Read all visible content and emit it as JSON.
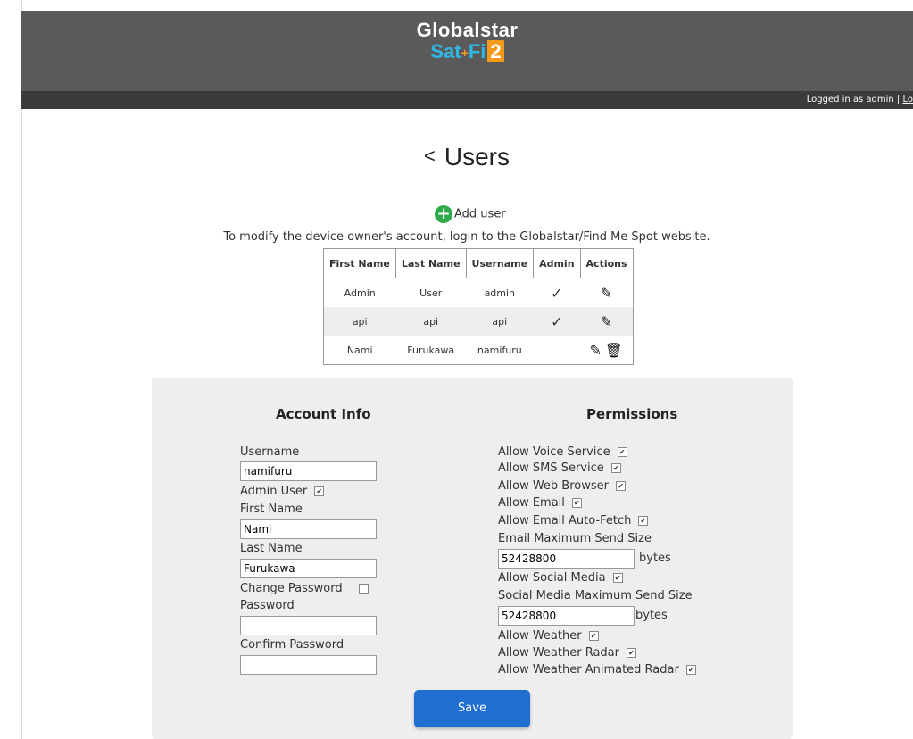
{
  "header": {
    "logo_line1": "Globalstar",
    "logo_sat": "Sat",
    "logo_fi": "Fi",
    "logo_two": "2",
    "logged_in": "Logged in as admin | ",
    "logout_link": "Lo"
  },
  "page": {
    "title": "Users",
    "add_user": "Add user",
    "note": "To modify the device owner's account, login to the Globalstar/Find Me Spot website."
  },
  "table": {
    "headers": [
      "First Name",
      "Last Name",
      "Username",
      "Admin",
      "Actions"
    ],
    "rows": [
      {
        "first": "Admin",
        "last": "User",
        "username": "admin",
        "admin": true,
        "delete": false
      },
      {
        "first": "api",
        "last": "api",
        "username": "api",
        "admin": true,
        "delete": false
      },
      {
        "first": "Nami",
        "last": "Furukawa",
        "username": "namifuru",
        "admin": false,
        "delete": true
      }
    ]
  },
  "account": {
    "heading": "Account Info",
    "username_label": "Username",
    "username_value": "namifuru",
    "admin_user_label": "Admin User",
    "admin_user_checked": true,
    "first_name_label": "First Name",
    "first_name_value": "Nami",
    "last_name_label": "Last Name",
    "last_name_value": "Furukawa",
    "change_password_label": "Change Password",
    "change_password_checked": false,
    "password_label": "Password",
    "password_value": "",
    "confirm_password_label": "Confirm Password",
    "confirm_password_value": ""
  },
  "permissions": {
    "heading": "Permissions",
    "voice": "Allow Voice Service",
    "sms": "Allow SMS Service",
    "web": "Allow Web Browser",
    "email": "Allow Email",
    "email_autofetch": "Allow Email Auto-Fetch",
    "email_max_label": "Email Maximum Send Size",
    "email_max_value": "52428800",
    "social": "Allow Social Media",
    "social_max_label": "Social Media Maximum Send Size",
    "social_max_value": "52428800",
    "weather": "Allow Weather",
    "weather_radar": "Allow Weather Radar",
    "weather_animated": "Allow Weather Animated Radar",
    "bytes_unit": "bytes"
  },
  "save_label": "Save",
  "icons": {
    "check": "✓",
    "checkbox_tick": "✔",
    "pencil": "✎",
    "trash": "🗑"
  },
  "colors": {
    "header_bg": "#5a5a5a",
    "statusbar_bg": "#3b3b3b",
    "save_button": "#1f6fd1",
    "add_icon": "#2eaa4a",
    "logo_blue": "#2fb7e6",
    "logo_orange": "#f39a1d"
  }
}
